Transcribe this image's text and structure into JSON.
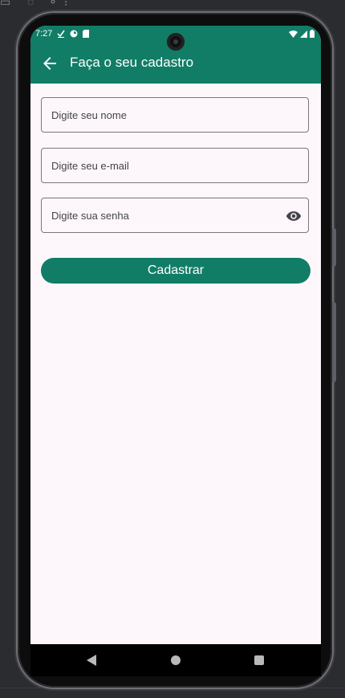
{
  "status_bar": {
    "time": "7:27"
  },
  "app_bar": {
    "title": "Faça o seu cadastro"
  },
  "form": {
    "name_placeholder": "Digite seu nome",
    "email_placeholder": "Digite seu e-mail",
    "password_placeholder": "Digite sua senha",
    "submit_label": "Cadastrar"
  },
  "colors": {
    "primary": "#117d66",
    "background": "#fdf7fc"
  },
  "icons": {
    "back": "arrow-back-icon",
    "password_toggle": "eye-icon"
  }
}
